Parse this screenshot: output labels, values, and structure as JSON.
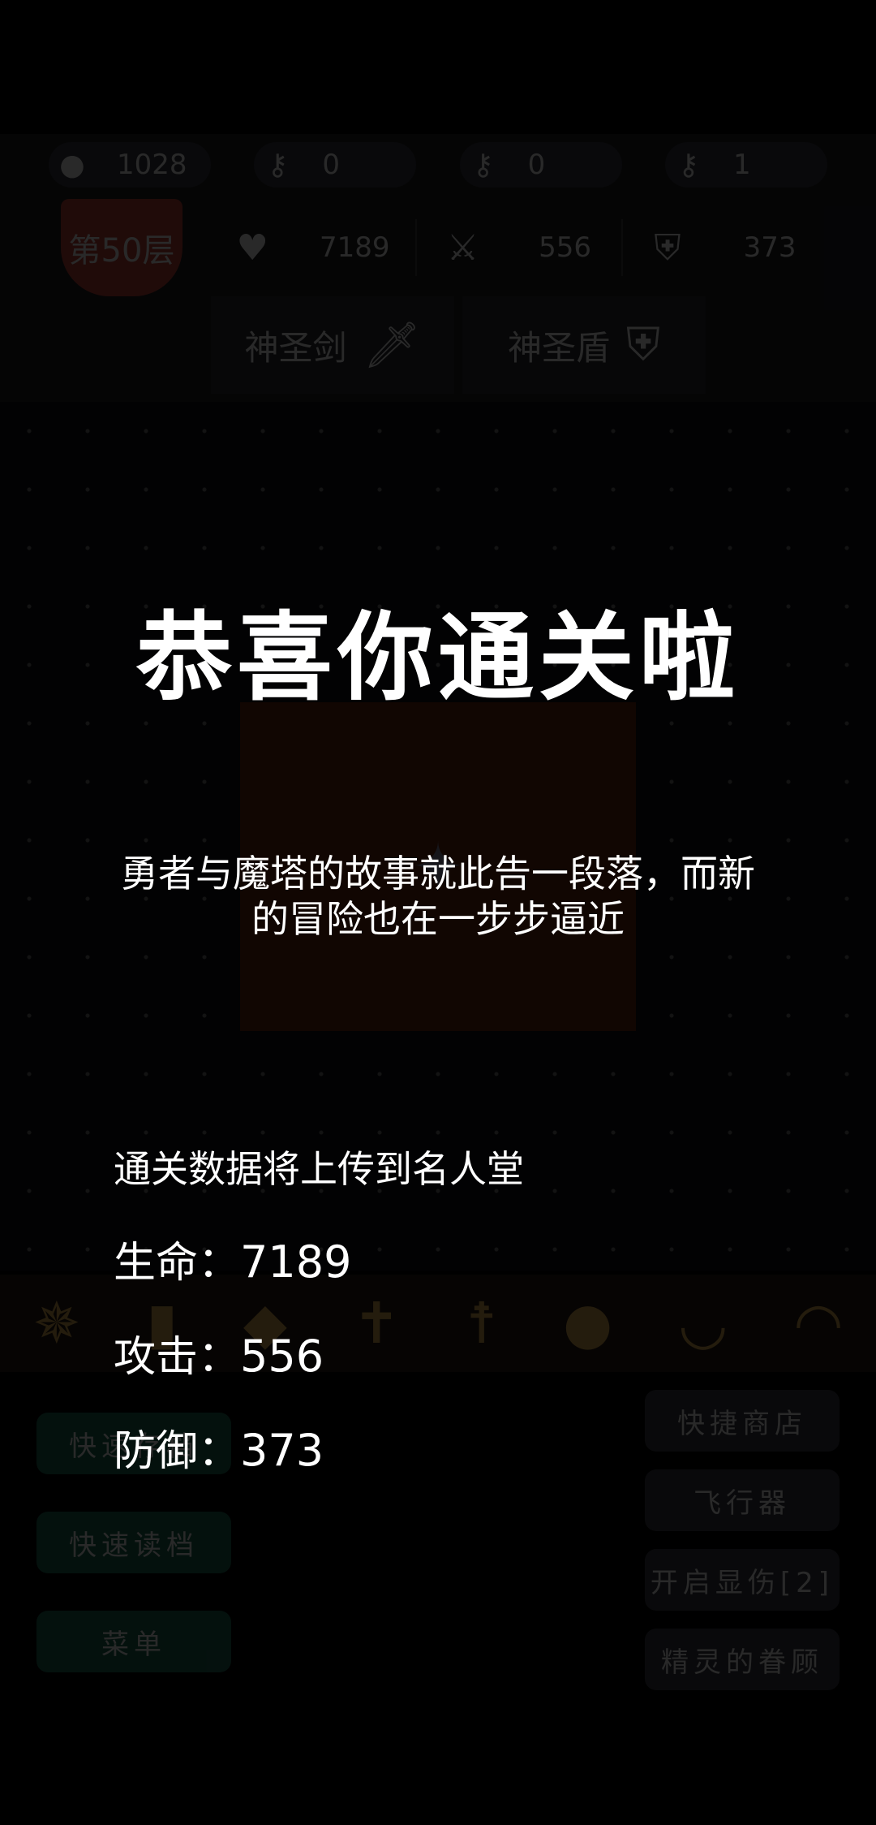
{
  "hud": {
    "resources": [
      {
        "icon": "coin-icon",
        "glyph": "●",
        "value": "1028"
      },
      {
        "icon": "yellow-key-icon",
        "glyph": "⚷",
        "value": "0"
      },
      {
        "icon": "blue-key-icon",
        "glyph": "⚷",
        "value": "0"
      },
      {
        "icon": "red-key-icon",
        "glyph": "⚷",
        "value": "1"
      }
    ],
    "floor_label": "第50层",
    "stats": [
      {
        "icon": "heart-icon",
        "glyph": "♥",
        "value": "7189"
      },
      {
        "icon": "crossed-swords-icon",
        "glyph": "⚔",
        "value": "556"
      },
      {
        "icon": "shield-icon",
        "glyph": "⛨",
        "value": "373"
      }
    ],
    "equipment": [
      {
        "label": "神圣剑",
        "icon": "sword-icon",
        "glyph": "🗡"
      },
      {
        "label": "神圣盾",
        "icon": "shield-icon",
        "glyph": "⛨"
      }
    ]
  },
  "toolbar_icons": [
    "compass-icon",
    "book-icon",
    "scroll-icon",
    "cross-icon",
    "staff-icon",
    "orb-icon",
    "wing-icon",
    "horn-icon"
  ],
  "side_buttons": {
    "left": [
      "快速存档",
      "快速读档",
      "菜单"
    ],
    "right": [
      "快捷商店",
      "飞行器",
      "开启显伤[2]",
      "精灵的眷顾"
    ]
  },
  "victory": {
    "title": "恭喜你通关啦",
    "message": "勇者与魔塔的故事就此告一段落，而新的冒险也在一步步逼近",
    "hall_notice": "通关数据将上传到名人堂",
    "stats": [
      {
        "label": "生命：",
        "value": "7189"
      },
      {
        "label": "攻击：",
        "value": "556"
      },
      {
        "label": "防御：",
        "value": "373"
      }
    ]
  },
  "colors": {
    "background": "#000000",
    "overlay_text": "#ffffff",
    "floor_badge": "#c9453a",
    "save_buttons": "#1d6b55"
  }
}
